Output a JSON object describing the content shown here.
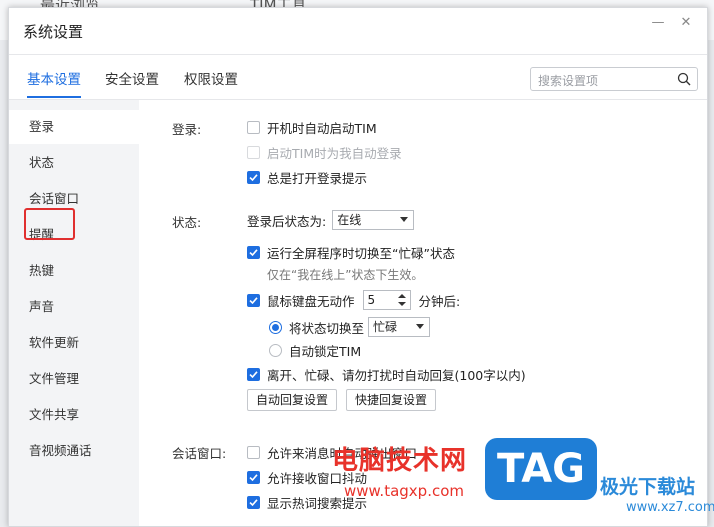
{
  "background": {
    "left_text": "最近浏览",
    "right_text": "TIM工具"
  },
  "dialog": {
    "title": "系统设置",
    "minimize_label": "—",
    "close_label": "✕"
  },
  "tabs": [
    {
      "label": "基本设置",
      "active": true
    },
    {
      "label": "安全设置",
      "active": false
    },
    {
      "label": "权限设置",
      "active": false
    }
  ],
  "search": {
    "placeholder": "搜索设置项"
  },
  "sidebar": {
    "items": [
      {
        "label": "登录"
      },
      {
        "label": "状态"
      },
      {
        "label": "会话窗口"
      },
      {
        "label": "提醒"
      },
      {
        "label": "热键"
      },
      {
        "label": "声音"
      },
      {
        "label": "软件更新"
      },
      {
        "label": "文件管理"
      },
      {
        "label": "文件共享"
      },
      {
        "label": "音视频通话"
      }
    ],
    "highlighted": "提醒"
  },
  "login": {
    "section_label": "登录:",
    "auto_start": {
      "label": "开机时自动启动TIM",
      "checked": false
    },
    "auto_login": {
      "label": "启动TIM时为我自动登录",
      "checked": false,
      "disabled": true
    },
    "show_prompt": {
      "label": "总是打开登录提示",
      "checked": true
    }
  },
  "status": {
    "section_label": "状态:",
    "after_login_label": "登录后状态为:",
    "after_login_value": "在线",
    "fullscreen_busy": {
      "label": "运行全屏程序时切换至“忙碌”状态",
      "checked": true
    },
    "fullscreen_hint": "仅在“我在线上”状态下生效。",
    "idle": {
      "label": "鼠标键盘无动作",
      "checked": true,
      "minutes": "5",
      "suffix": "分钟后:"
    },
    "switch_status": {
      "label": "将状态切换至",
      "selected": true,
      "value": "忙碌"
    },
    "auto_lock": {
      "label": "自动锁定TIM",
      "selected": false
    },
    "auto_reply": {
      "label": "离开、忙碌、请勿打扰时自动回复(100字以内)",
      "checked": true
    },
    "auto_reply_btn": "自动回复设置",
    "quick_reply_btn": "快捷回复设置"
  },
  "session": {
    "section_label": "会话窗口:",
    "allow_popup": {
      "label": "允许来消息时自动弹出窗口",
      "checked": false
    },
    "allow_shake": {
      "label": "允许接收窗口抖动",
      "checked": true
    },
    "show_hot": {
      "label": "显示热词搜索提示",
      "checked": true
    }
  },
  "watermark": {
    "cn": "电脑技术网",
    "url": "www.tagxp.com",
    "tag": "TAG",
    "site": "极光下载站",
    "site_url": "www.xz7.com"
  },
  "colors": {
    "accent": "#1e6ee0",
    "highlight_border": "#e02f2f",
    "watermark_red": "#e8322a",
    "watermark_blue": "#1f7ed6"
  }
}
